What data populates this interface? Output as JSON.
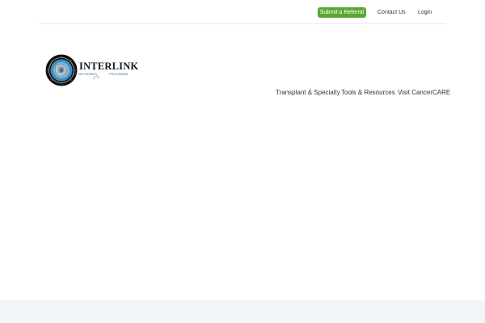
{
  "topbar": {
    "referral_label": "Submit a Referral",
    "contact_label": "Contact Us",
    "login_label": "Login"
  },
  "logo": {
    "wordmark": "INTERLINK",
    "tagline_left": "COE NETWORKS",
    "tagline_right": "PROGRAMS",
    "icon": "interlink-seal-icon"
  },
  "nav": {
    "items": [
      {
        "label": "Transplant & Specialty"
      },
      {
        "label": "Tools & Resources"
      },
      {
        "label": "Visit CancerCARE"
      }
    ]
  },
  "colors": {
    "accent": "#5aa832",
    "text": "#333333",
    "footer_bg": "#f0f5f8",
    "logo_blue": "#2b6fa6"
  }
}
